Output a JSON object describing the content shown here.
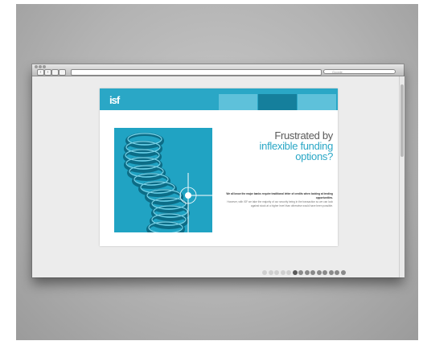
{
  "browser": {
    "title": "",
    "url": "",
    "search_placeholder": "Google",
    "back_label": "‹",
    "forward_label": "›"
  },
  "site": {
    "logo": "isf",
    "logo_tagline": "",
    "nav": [
      {
        "label": "",
        "active": false
      },
      {
        "label": "",
        "active": true
      },
      {
        "label": "",
        "active": false
      }
    ],
    "headline_line1": "Frustrated by",
    "headline_line2": "inflexible funding",
    "headline_line3": "options?",
    "body_lead": "We all know the major banks require traditional letter of credits when looking at lending opportunities.",
    "body_rest": "However, with ISF we take the majority of our security being in the transaction so we can look against stock at a higher level than otherwise would have been possible.",
    "cta": "",
    "footer_left": "",
    "pager_count": 14,
    "pager_active": 5
  },
  "colors": {
    "accent": "#2aa7c6",
    "accent_dark": "#157f9c",
    "headline_grey": "#5a5a5a",
    "page_bg": "#ececec"
  }
}
